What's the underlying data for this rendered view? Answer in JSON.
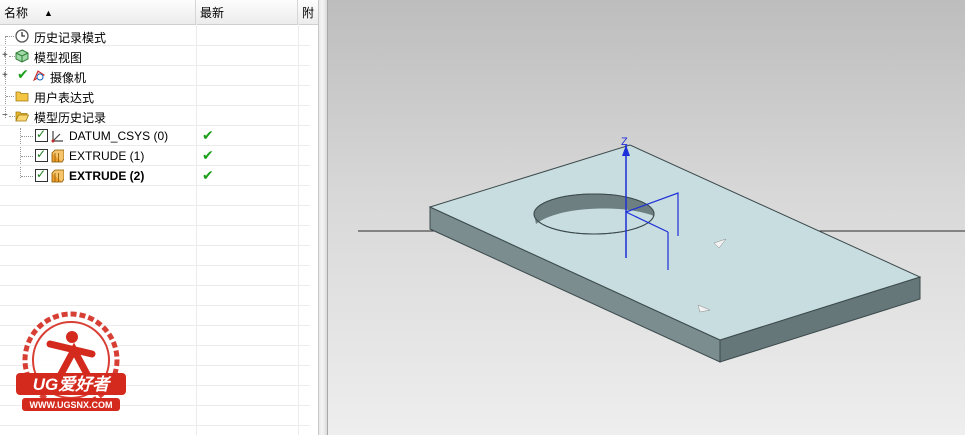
{
  "nav": {
    "columns": {
      "name": "名称",
      "latest": "最新",
      "extra": "附"
    },
    "rows": [
      {
        "label": "历史记录模式",
        "icon": "clock-icon"
      },
      {
        "label": "模型视图",
        "icon": "model-view-icon"
      },
      {
        "label": "摄像机",
        "icon": "camera-icon"
      },
      {
        "label": "用户表达式",
        "icon": "folder-icon"
      },
      {
        "label": "模型历史记录",
        "icon": "folder-open-icon"
      },
      {
        "label": "DATUM_CSYS (0)",
        "icon": "datum-csys-icon",
        "latest": "✔"
      },
      {
        "label": "EXTRUDE (1)",
        "icon": "extrude-icon",
        "latest": "✔"
      },
      {
        "label": "EXTRUDE (2)",
        "icon": "extrude-icon",
        "latest": "✔"
      }
    ]
  },
  "logo": {
    "brand": "UG爱好者",
    "url": "WWW.UGSNX.COM"
  },
  "viewport": {
    "axis_label": "Z"
  }
}
